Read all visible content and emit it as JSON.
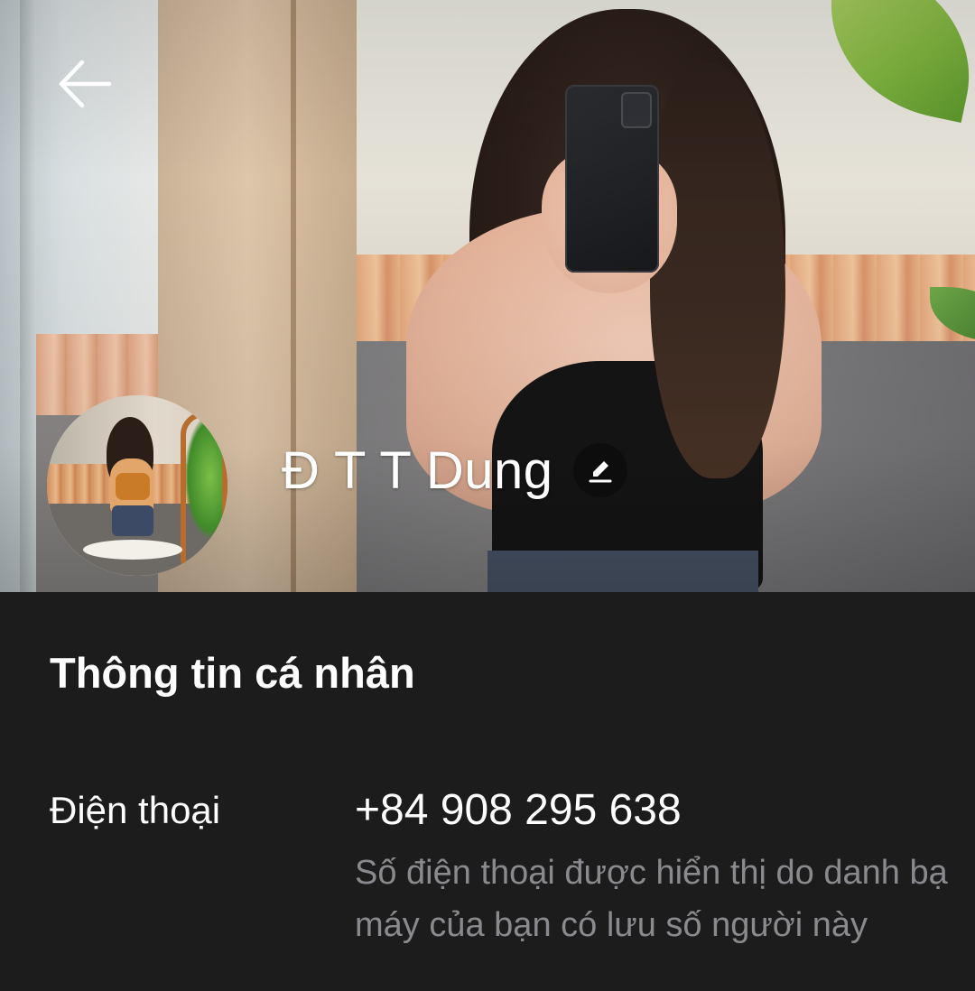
{
  "profile": {
    "name": "Đ T T Dung"
  },
  "info": {
    "section_title": "Thông tin cá nhân",
    "phone_label": "Điện thoại",
    "phone_value": "+84 908 295 638",
    "phone_note": "Số điện thoại được hiển thị do danh bạ máy của bạn có lưu số người này"
  },
  "icons": {
    "back": "arrow-left-icon",
    "edit": "pencil-icon"
  },
  "colors": {
    "background": "#1c1c1c",
    "primary_text": "#ffffff",
    "secondary_text": "#8a8a8e",
    "edit_button_bg": "#0d0d0d"
  }
}
